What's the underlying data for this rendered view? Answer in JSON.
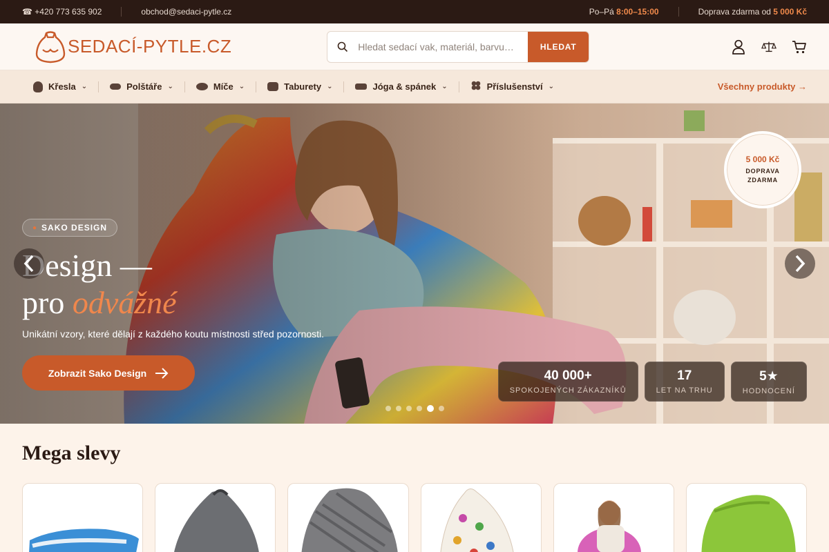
{
  "topbar": {
    "phone": "☎ +420 773 635 902",
    "email": "obchod@sedaci-pytle.cz",
    "hours_label": "Po–Pá",
    "hours_value": "8:00–15:00",
    "shipping_label": "Doprava zdarma od",
    "shipping_value": "5 000 Kč"
  },
  "header": {
    "logo_text": "SEDACÍ-PYTLE.CZ",
    "search_placeholder": "Hledat sedací vak, materiál, barvu…",
    "search_button": "HLEDAT",
    "icons": [
      "user-icon",
      "compare-scale-icon",
      "cart-icon"
    ]
  },
  "nav": {
    "items": [
      {
        "label": "Křesla",
        "icon": "beanbag-icon"
      },
      {
        "label": "Polštáře",
        "icon": "pillow-icon"
      },
      {
        "label": "Míče",
        "icon": "ball-icon"
      },
      {
        "label": "Taburety",
        "icon": "pouf-icon"
      },
      {
        "label": "Jóga & spánek",
        "icon": "mat-icon"
      },
      {
        "label": "Příslušenství",
        "icon": "accessory-icon"
      }
    ],
    "all_products": "Všechny produkty →"
  },
  "hero": {
    "badge": "SAKO DESIGN",
    "title_line1": "Design —",
    "title_line2_plain": "pro ",
    "title_line2_accent": "odvážné",
    "subtitle": "Unikátní vzory, které dělají z každého koutu místnosti střed pozornosti.",
    "cta": "Zobrazit Sako Design",
    "seal_value": "5 000 Kč",
    "seal_line1": "DOPRAVA",
    "seal_line2": "ZDARMA",
    "stats": [
      {
        "value": "40 000+",
        "label": "SPOKOJENÝCH ZÁKAZNÍKŮ"
      },
      {
        "value": "17",
        "label": "LET NA TRHU"
      },
      {
        "value": "5★",
        "label": "HODNOCENÍ"
      }
    ],
    "slide_count": 6,
    "active_slide": 5
  },
  "sale": {
    "title": "Mega slevy"
  },
  "colors": {
    "accent": "#c85a2a",
    "dark": "#2b1a14",
    "background": "#fdf3ea"
  }
}
